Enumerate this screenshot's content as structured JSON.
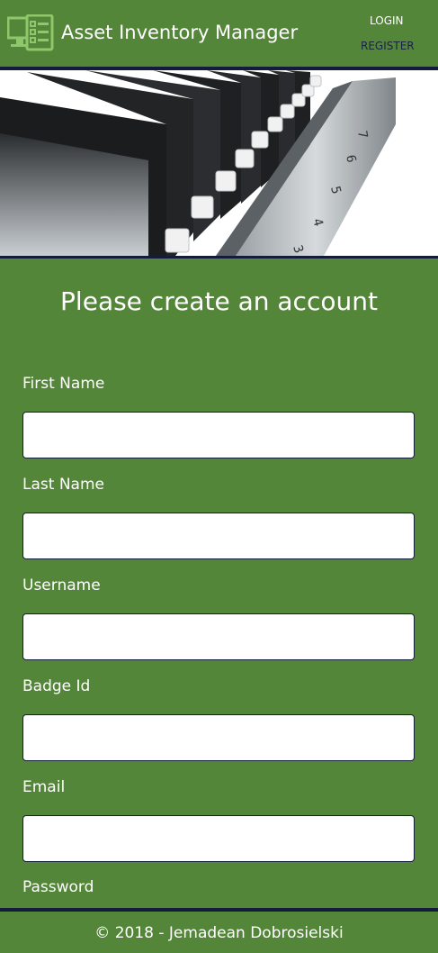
{
  "header": {
    "title": "Asset Inventory Manager",
    "logo_icon": "checklist-clipboard-icon",
    "nav": {
      "login": "LOGIN",
      "register": "REGISTER"
    }
  },
  "hero": {
    "image": "tablet-charging-cart-photo",
    "slot_numbers": [
      "7",
      "6",
      "5",
      "4",
      "3"
    ]
  },
  "main": {
    "title": "Please create an account",
    "fields": [
      {
        "label": "First Name",
        "value": ""
      },
      {
        "label": "Last Name",
        "value": ""
      },
      {
        "label": "Username",
        "value": ""
      },
      {
        "label": "Badge Id",
        "value": ""
      },
      {
        "label": "Email",
        "value": ""
      },
      {
        "label": "Password",
        "value": ""
      }
    ]
  },
  "footer": {
    "text": "© 2018 - Jemadean Dobrosielski"
  },
  "colors": {
    "brand_green": "#548639",
    "navy": "#141c3b",
    "white": "#ffffff"
  }
}
